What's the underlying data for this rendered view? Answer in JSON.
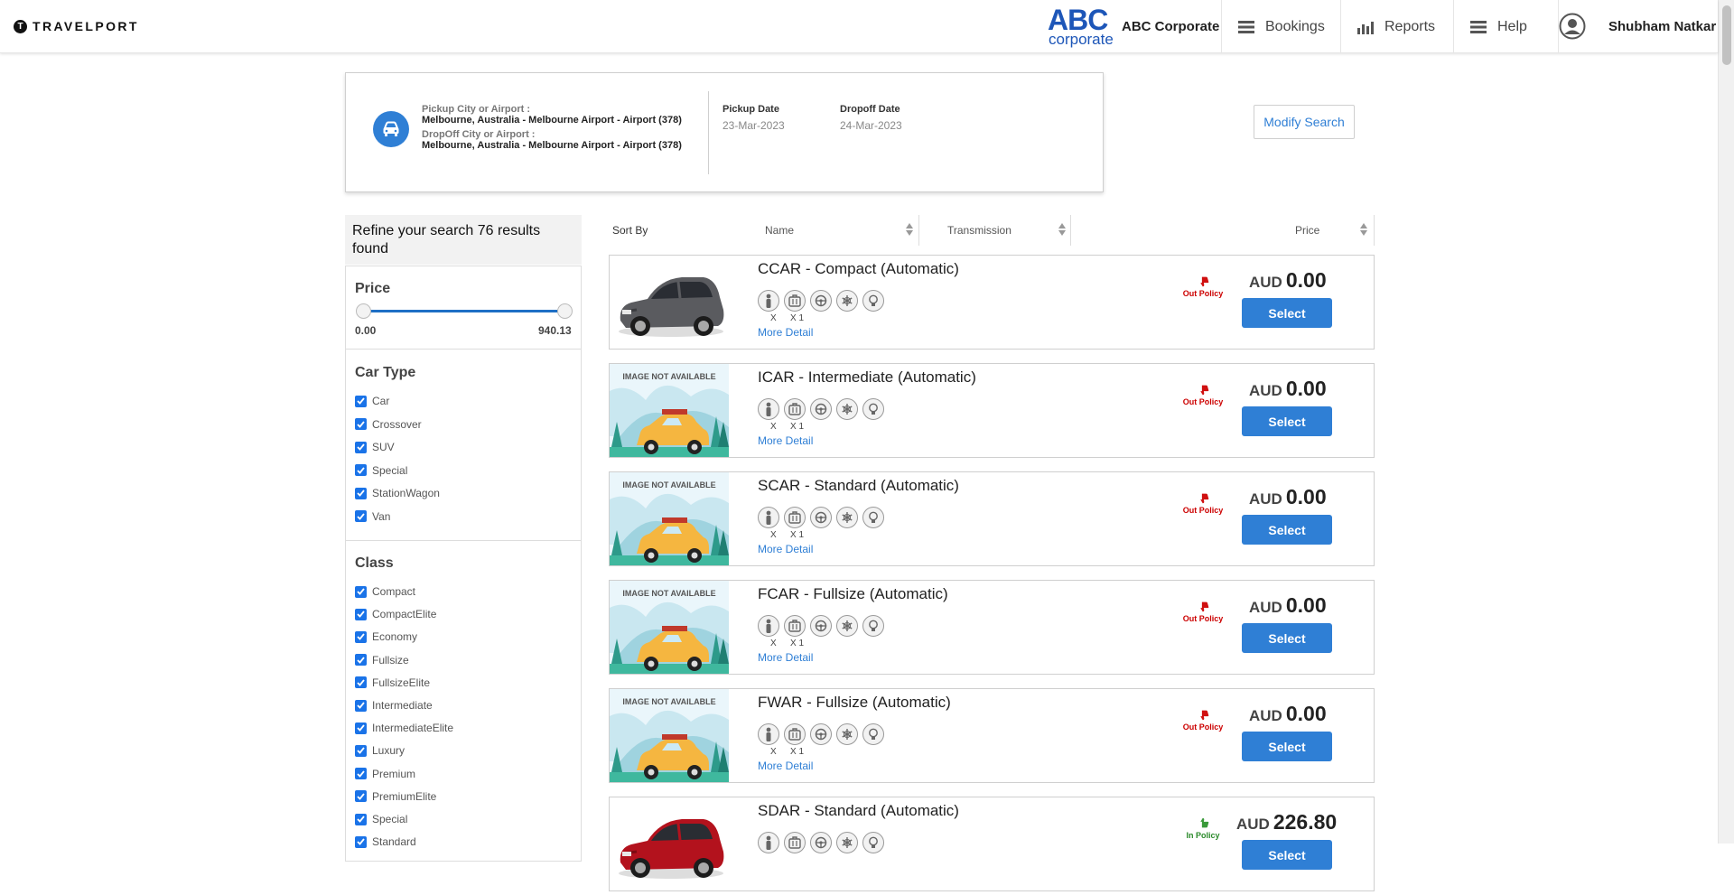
{
  "header": {
    "brand": "TRAVELPORT",
    "corp_logo_big": "ABC",
    "corp_logo_small": "corporate",
    "corp_name": "ABC Corporate",
    "nav": [
      {
        "label": "Bookings"
      },
      {
        "label": "Reports"
      },
      {
        "label": "Help"
      }
    ],
    "user_name": "Shubham Natkar"
  },
  "search": {
    "pickup_label": "Pickup City or Airport :",
    "pickup_value": "Melbourne, Australia - Melbourne Airport - Airport (378)",
    "dropoff_label": "DropOff City or Airport :",
    "dropoff_value": "Melbourne, Australia - Melbourne Airport - Airport (378)",
    "pickup_date_label": "Pickup Date",
    "pickup_date": "23-Mar-2023",
    "dropoff_date_label": "Dropoff Date",
    "dropoff_date": "24-Mar-2023",
    "modify_label": "Modify Search"
  },
  "refine": {
    "header": "Refine your search 76 results found",
    "price_title": "Price",
    "price_min": "0.00",
    "price_max": "940.13",
    "car_type_title": "Car Type",
    "car_types": [
      "Car",
      "Crossover",
      "SUV",
      "Special",
      "StationWagon",
      "Van"
    ],
    "class_title": "Class",
    "classes": [
      "Compact",
      "CompactElite",
      "Economy",
      "Fullsize",
      "FullsizeElite",
      "Intermediate",
      "IntermediateElite",
      "Luxury",
      "Premium",
      "PremiumElite",
      "Special",
      "Standard"
    ]
  },
  "sort": {
    "label": "Sort By",
    "columns": [
      "Name",
      "Transmission",
      "Price"
    ]
  },
  "image_na_text": "IMAGE NOT AVAILABLE",
  "results": [
    {
      "title": "CCAR - Compact (Automatic)",
      "image": "photo-gray",
      "people": "X",
      "bags": "X 1",
      "more": "More Detail",
      "policy": "Out Policy",
      "currency": "AUD",
      "price": "0.00",
      "select": "Select"
    },
    {
      "title": "ICAR - Intermediate (Automatic)",
      "image": "na",
      "people": "X",
      "bags": "X 1",
      "more": "More Detail",
      "policy": "Out Policy",
      "currency": "AUD",
      "price": "0.00",
      "select": "Select"
    },
    {
      "title": "SCAR - Standard (Automatic)",
      "image": "na",
      "people": "X",
      "bags": "X 1",
      "more": "More Detail",
      "policy": "Out Policy",
      "currency": "AUD",
      "price": "0.00",
      "select": "Select"
    },
    {
      "title": "FCAR - Fullsize (Automatic)",
      "image": "na",
      "people": "X",
      "bags": "X 1",
      "more": "More Detail",
      "policy": "Out Policy",
      "currency": "AUD",
      "price": "0.00",
      "select": "Select"
    },
    {
      "title": "FWAR - Fullsize (Automatic)",
      "image": "na",
      "people": "X",
      "bags": "X 1",
      "more": "More Detail",
      "policy": "Out Policy",
      "currency": "AUD",
      "price": "0.00",
      "select": "Select"
    },
    {
      "title": "SDAR - Standard (Automatic)",
      "image": "photo-red",
      "people": "",
      "bags": "",
      "more": "",
      "policy": "In Policy",
      "currency": "AUD",
      "price": "226.80",
      "select": "Select"
    }
  ],
  "colors": {
    "accent": "#2f7fd5",
    "out_policy": "#cc0000",
    "in_policy": "#2a8a2a"
  }
}
